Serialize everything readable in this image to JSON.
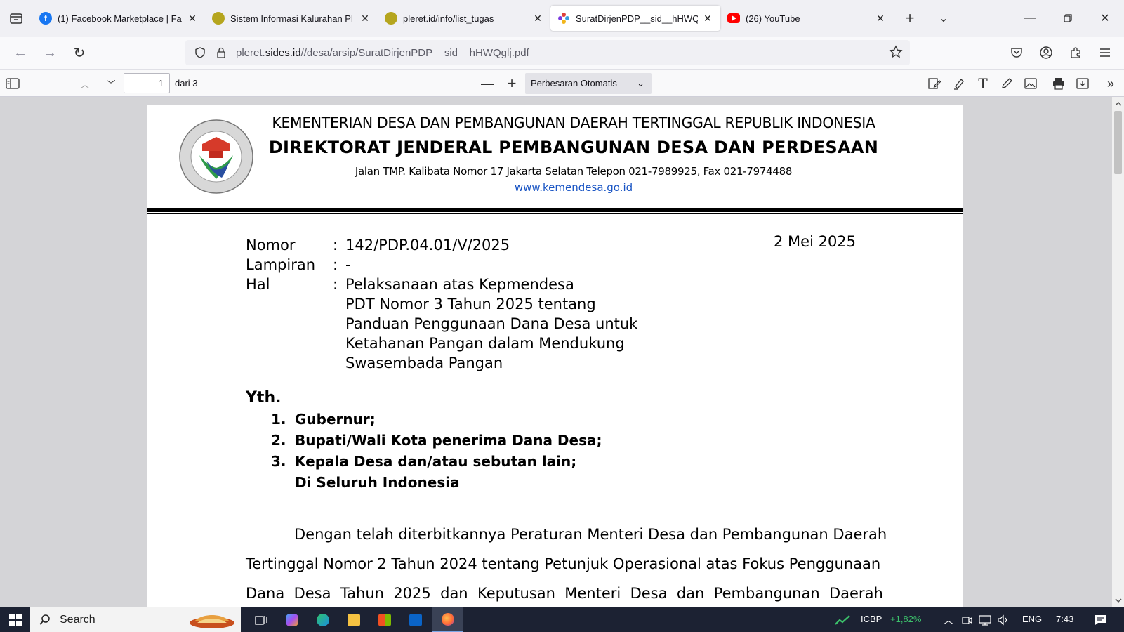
{
  "tabs": [
    {
      "label": "(1) Facebook Marketplace | Fa",
      "icon": "facebook-icon",
      "active": false
    },
    {
      "label": "Sistem Informasi Kalurahan Pl",
      "icon": "kalurahan-crest-icon",
      "active": false
    },
    {
      "label": "pleret.id/info/list_tugas",
      "icon": "kalurahan-crest-icon",
      "active": false
    },
    {
      "label": "SuratDirjenPDP__sid__hHWQ",
      "icon": "pdf-puzzle-icon",
      "active": true
    },
    {
      "label": "(26) YouTube",
      "icon": "youtube-icon",
      "active": false
    }
  ],
  "address": {
    "host_prefix": "pleret.",
    "host": "sides.id",
    "path": "//desa/arsip/SuratDirjenPDP__sid__hHWQglj.pdf"
  },
  "pdf_toolbar": {
    "page_number": "1",
    "page_total": "dari 3",
    "zoom": "Perbesaran Otomatis"
  },
  "letterhead": {
    "line1": "KEMENTERIAN DESA DAN PEMBANGUNAN DAERAH TERTINGGAL REPUBLIK INDONESIA",
    "line2": "DIREKTORAT JENDERAL PEMBANGUNAN DESA DAN PERDESAAN",
    "address": "Jalan  TMP. Kalibata Nomor 17 Jakarta Selatan Telepon  021-7989925, Fax 021-7974488",
    "website": "www.kemendesa.go.id"
  },
  "letter": {
    "date": "2 Mei 2025",
    "nomor_label": "Nomor",
    "nomor_value": "142/PDP.04.01/V/2025",
    "lampiran_label": "Lampiran",
    "lampiran_value": "-",
    "hal_label": "Hal",
    "colon": ":",
    "hal_lines": [
      "Pelaksanaan atas Kepmendesa",
      "PDT Nomor 3 Tahun 2025 tentang",
      "Panduan Penggunaan Dana Desa untuk",
      "Ketahanan Pangan dalam Mendukung",
      "Swasembada Pangan"
    ],
    "yth": "Yth.",
    "recipients": [
      {
        "num": "1.",
        "text": "Gubernur;"
      },
      {
        "num": "2.",
        "text": "Bupati/Wali Kota penerima Dana Desa;"
      },
      {
        "num": "3.",
        "text": "Kepala Desa dan/atau sebutan lain;"
      }
    ],
    "recipient_location": "Di Seluruh Indonesia",
    "body_lines": [
      "Dengan telah diterbitkannya Peraturan Menteri Desa dan Pembangunan Daerah",
      "Tertinggal Nomor 2 Tahun 2024 tentang Petunjuk Operasional atas Fokus Penggunaan",
      "Dana  Desa  Tahun  2025  dan  Keputusan  Menteri  Desa  dan  Pembangunan  Daerah"
    ]
  },
  "taskbar": {
    "search": "Search",
    "ticker": "ICBP",
    "ticker_change": "+1,82%",
    "language": "ENG",
    "time": "7:43"
  },
  "colors": {
    "ticker_up": "#3cc26b",
    "link": "#1a55c4",
    "youtube": "#ff0000",
    "facebook": "#1877f2"
  }
}
